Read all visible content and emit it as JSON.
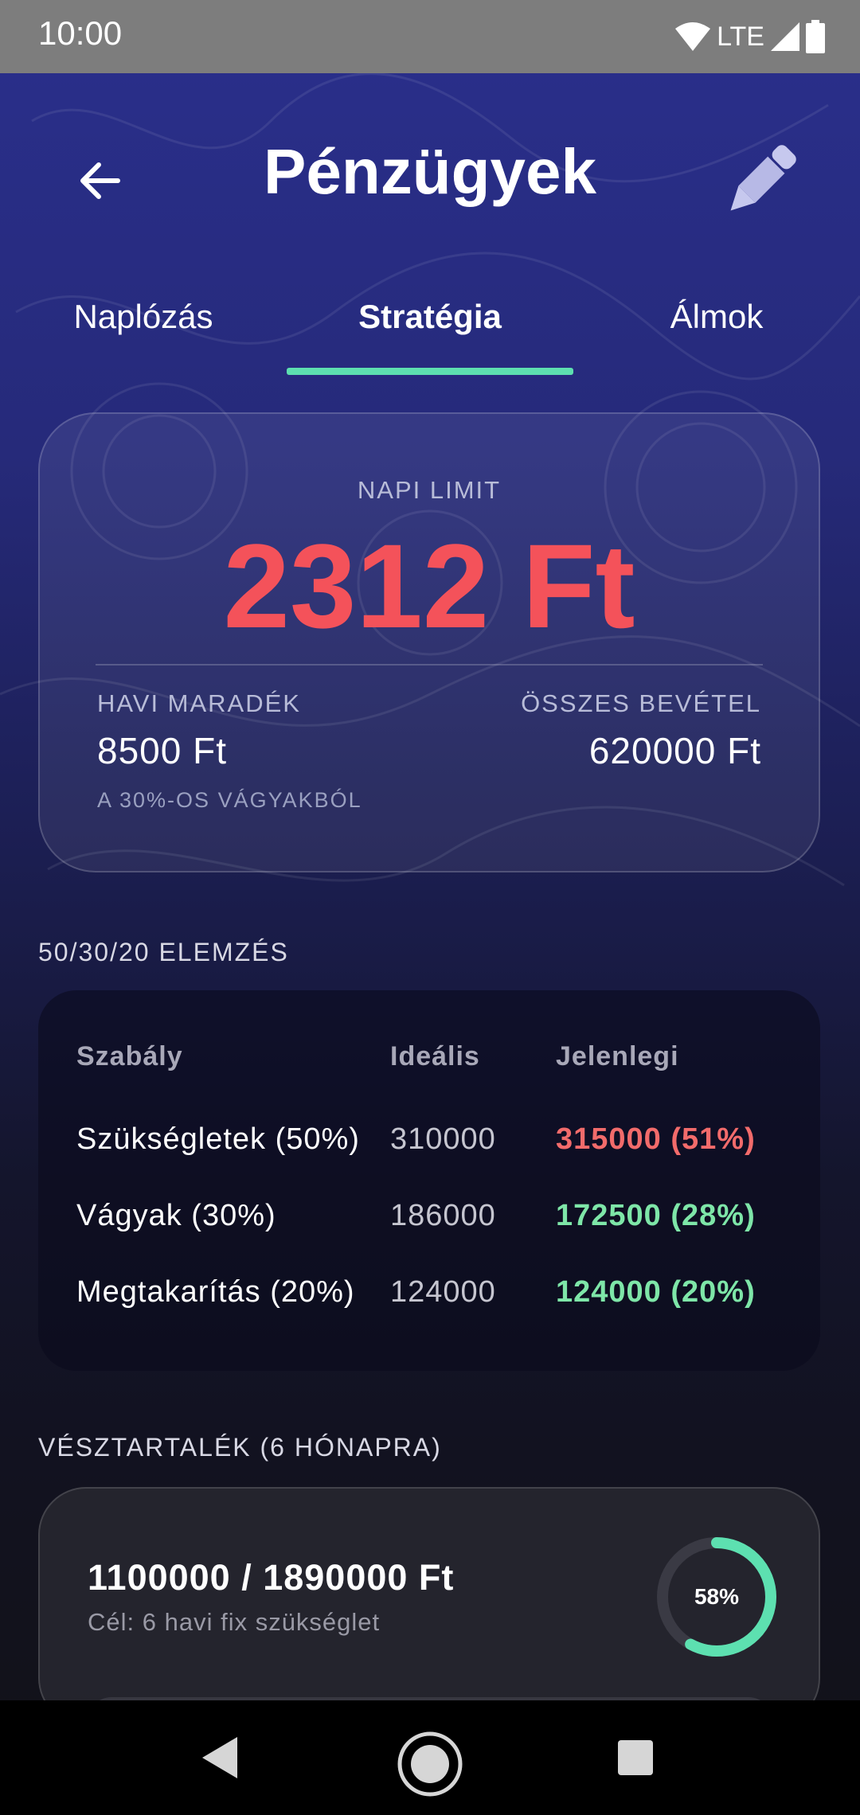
{
  "status_bar": {
    "time": "10:00",
    "network": "LTE"
  },
  "header": {
    "title": "Pénzügyek"
  },
  "tabs": [
    {
      "label": "Naplózás",
      "active": false
    },
    {
      "label": "Stratégia",
      "active": true
    },
    {
      "label": "Álmok",
      "active": false
    }
  ],
  "limit_card": {
    "label": "NAPI LIMIT",
    "value": "2312 Ft",
    "monthly_remaining_label": "HAVI MARADÉK",
    "monthly_remaining_value": "8500 Ft",
    "monthly_remaining_note": "A 30%-OS VÁGYAKBÓL",
    "total_income_label": "ÖSSZES BEVÉTEL",
    "total_income_value": "620000 Ft"
  },
  "analysis": {
    "section_title": "50/30/20 ELEMZÉS",
    "headers": [
      "Szabály",
      "Ideális",
      "Jelenlegi"
    ],
    "rows": [
      {
        "rule": "Szükségletek (50%)",
        "ideal": "310000",
        "current": "315000 (51%)",
        "status": "over"
      },
      {
        "rule": "Vágyak (30%)",
        "ideal": "186000",
        "current": "172500 (28%)",
        "status": "ok"
      },
      {
        "rule": "Megtakarítás (20%)",
        "ideal": "124000",
        "current": "124000 (20%)",
        "status": "ok"
      }
    ]
  },
  "emergency": {
    "section_title": "VÉSZTARTALÉK (6 HÓNAPRA)",
    "value": "1100000 / 1890000 Ft",
    "goal": "Cél: 6 havi fix szükséglet",
    "progress_label": "58%",
    "progress": 0.58
  },
  "colors": {
    "accent": "#5de0b0",
    "negative": "#f4525a",
    "over": "#f26b6b",
    "ok": "#7ee6a8"
  }
}
